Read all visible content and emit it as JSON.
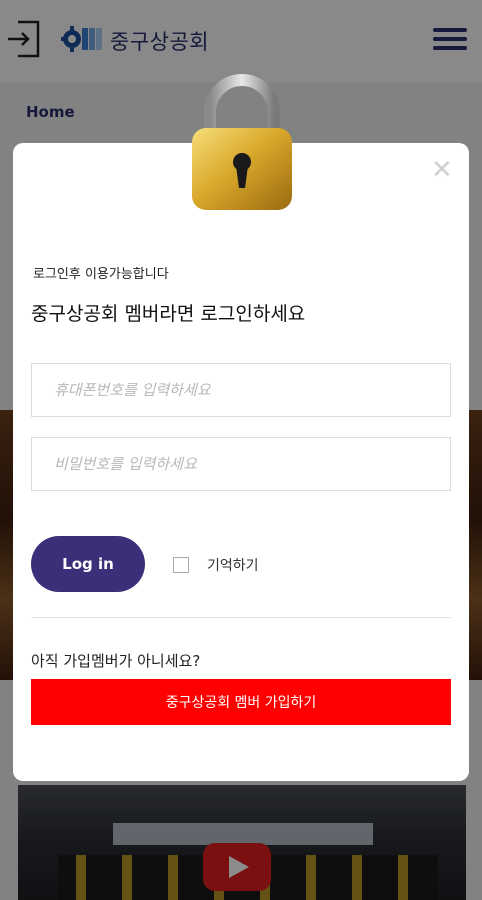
{
  "header": {
    "brand": "중구상공회",
    "login_icon": "login-arrow-icon",
    "logo_icon": "gear-logo-icon",
    "menu_icon": "hamburger-menu-icon",
    "brand_color": "#2a2f6e"
  },
  "page": {
    "breadcrumb": "Home",
    "video_play_icon": "play-icon"
  },
  "modal": {
    "close_icon": "close-icon",
    "lock_icon": "padlock-icon",
    "subtitle": "로그인후 이용가능합니다",
    "title": "중구상공회 멤버라면 로그인하세요",
    "phone_placeholder": "휴대폰번호를 입력하세요",
    "password_placeholder": "비밀번호를 입력하세요",
    "login_button": "Log in",
    "remember_label": "기억하기",
    "remember_checked": false,
    "not_member_text": "아직 가입멤버가 아니세요?",
    "signup_button": "중구상공회 멤버 가입하기",
    "colors": {
      "login_button": "#3a2f78",
      "signup_button": "#ff0000"
    }
  }
}
